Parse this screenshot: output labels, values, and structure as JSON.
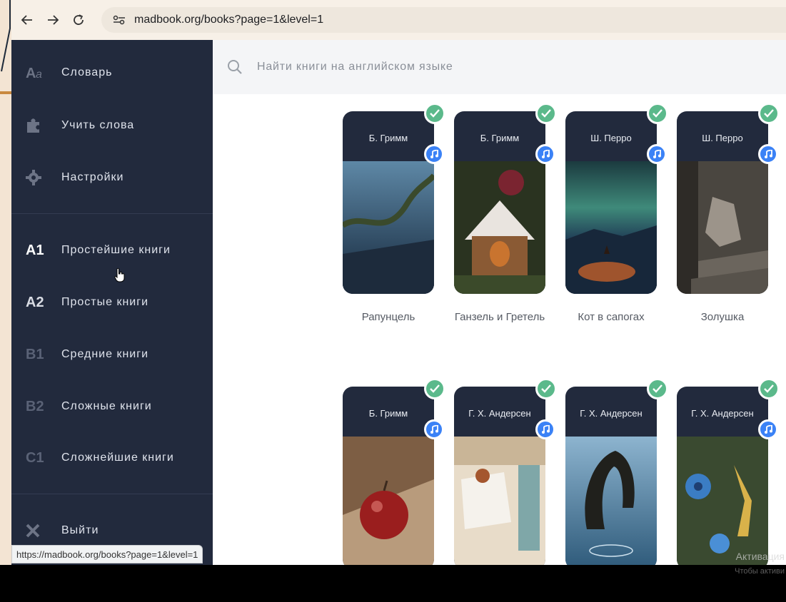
{
  "browser": {
    "url": "madbook.org/books?page=1&level=1",
    "status_url": "https://madbook.org/books?page=1&level=1"
  },
  "sidebar": {
    "top_items": [
      {
        "label": "Словарь",
        "icon": "dictionary-icon"
      },
      {
        "label": "Учить слова",
        "icon": "puzzle-icon"
      },
      {
        "label": "Настройки",
        "icon": "gear-icon"
      }
    ],
    "levels": [
      {
        "level": "A1",
        "label": "Простейшие книги",
        "active": true
      },
      {
        "level": "A2",
        "label": "Простые книги",
        "active": false
      },
      {
        "level": "B1",
        "label": "Средние книги",
        "active": false
      },
      {
        "level": "B2",
        "label": "Сложные книги",
        "active": false
      },
      {
        "level": "C1",
        "label": "Сложнейшие книги",
        "active": false
      }
    ],
    "logout": {
      "label": "Выйти",
      "icon": "close-icon"
    }
  },
  "search": {
    "placeholder": "Найти книги на английском языке"
  },
  "books": [
    {
      "author": "Б. Гримм",
      "title": "Рапунцель"
    },
    {
      "author": "Б. Гримм",
      "title": "Ганзель и Гретель"
    },
    {
      "author": "Ш. Перро",
      "title": "Кот в сапогах"
    },
    {
      "author": "Ш. Перро",
      "title": "Золушка"
    },
    {
      "author": "Б. Гримм",
      "title": ""
    },
    {
      "author": "Г. Х. Андерсен",
      "title": ""
    },
    {
      "author": "Г. Х. Андерсен",
      "title": ""
    },
    {
      "author": "Г. Х. Андерсен",
      "title": ""
    }
  ],
  "watermark": {
    "line1": "Активация",
    "line2": "Чтобы активи"
  },
  "colors": {
    "sidebar_bg": "#222a3d",
    "check_green": "#5bb98b",
    "audio_blue": "#3b82f6"
  }
}
